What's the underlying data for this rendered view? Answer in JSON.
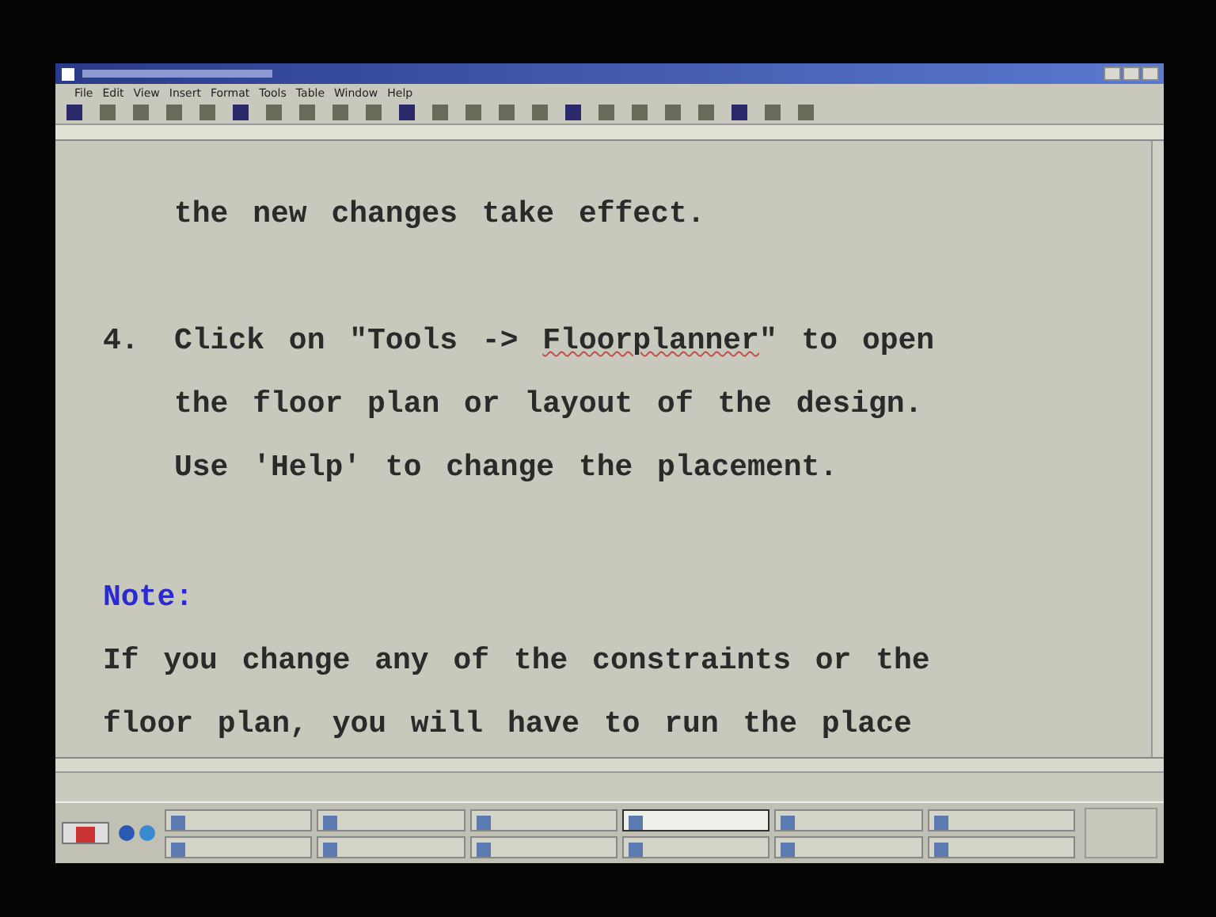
{
  "window": {
    "menu": [
      "File",
      "Edit",
      "View",
      "Insert",
      "Format",
      "Tools",
      "Table",
      "Window",
      "Help"
    ]
  },
  "document": {
    "blocks": [
      {
        "kind": "continuation",
        "lines": [
          [
            {
              "text": "the new changes take effect.",
              "misspelled": false
            }
          ]
        ]
      },
      {
        "kind": "list_item",
        "number": "4.",
        "lines": [
          [
            {
              "text": "Click on \"Tools -> ",
              "misspelled": false
            },
            {
              "text": "Floorplanner",
              "misspelled": true
            },
            {
              "text": "\" to open",
              "misspelled": false
            }
          ],
          [
            {
              "text": "the floor plan or layout of the design.",
              "misspelled": false
            }
          ],
          [
            {
              "text": "Use 'Help' to change the placement.",
              "misspelled": false
            }
          ]
        ]
      },
      {
        "kind": "heading",
        "lines": [
          [
            {
              "text": "Note:",
              "misspelled": false
            }
          ]
        ]
      },
      {
        "kind": "paragraph",
        "lines": [
          [
            {
              "text": "If you change any of the constraints or the",
              "misspelled": false
            }
          ],
          [
            {
              "text": "floor plan, you will have to run the place",
              "misspelled": false
            }
          ]
        ]
      }
    ]
  },
  "taskbar": {
    "rows": [
      [
        {
          "selected": false
        },
        {
          "selected": false
        },
        {
          "selected": false
        },
        {
          "selected": true
        },
        {
          "selected": false
        },
        {
          "selected": false
        }
      ],
      [
        {
          "selected": false
        },
        {
          "selected": false
        },
        {
          "selected": false
        },
        {
          "selected": false
        },
        {
          "selected": false
        },
        {
          "selected": false
        }
      ]
    ]
  }
}
